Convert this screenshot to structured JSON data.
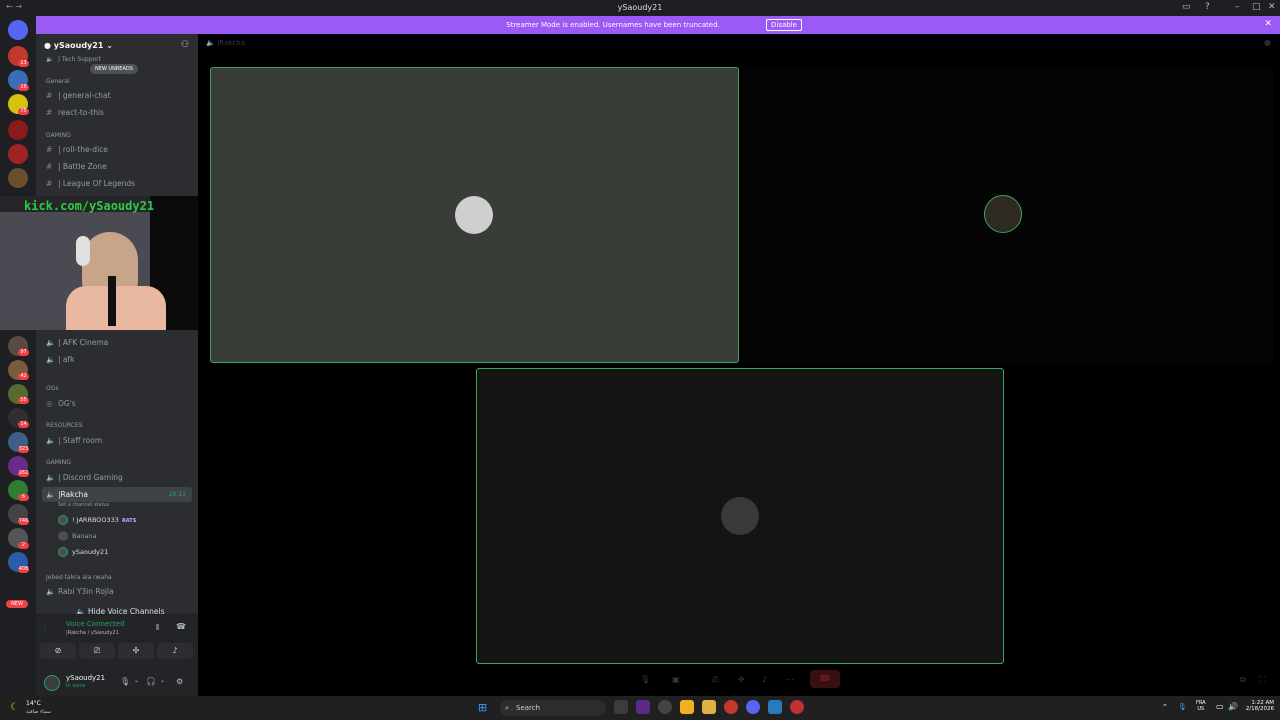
{
  "window": {
    "title": "ySaoudy21"
  },
  "banner": {
    "message": "Streamer Mode is enabled. Usernames have been truncated.",
    "disable_label": "Disable"
  },
  "server": {
    "name": "ySaoudy21",
    "new_unreads": "NEW UNREADS"
  },
  "channels": {
    "tech_support": "| Tech Support",
    "cat_general": "General",
    "general_chat": "| general-chat",
    "react_to_this": "react-to-this",
    "cat_gaming": "GAMING",
    "roll_the_dice": "| roll-the-dice",
    "battle_zone": "| Battle Zone",
    "league": "| League Of Legends",
    "afk_cinema": "| AFK Cinema",
    "afk": "| afk",
    "cat_ogs": "OGs",
    "ogs": "OG's",
    "cat_resources": "RESOURCES",
    "staff_room": "| Staff room",
    "cat_gaming2": "GAMING",
    "discord_gaming": "| Discord Gaming",
    "rakcha": "|Rakcha",
    "rakcha_timer": "26:11",
    "rakcha_status": "Set a channel status",
    "users": [
      "! JARRBOO333",
      "Banana",
      "ySaoudy21"
    ],
    "rats_tag": "RATS",
    "cat_jebed": "Jebed takra ala rwaha",
    "rabi": "Rabi Y3in Rojla",
    "hide_voice": "Hide Voice Channels"
  },
  "voice": {
    "title": "Voice Connected",
    "sub": "|Rakcha / ySaoudy21"
  },
  "user": {
    "name": "ySaoudy21",
    "status": "In voice"
  },
  "webcam": {
    "overlay": "kick.com/ySaoudy21"
  },
  "main": {
    "header": "|Rakcha"
  },
  "taskbar": {
    "weather_temp": "14°C",
    "weather_desc": "سماء صافية",
    "search": "Search",
    "lang1": "FRA",
    "lang2": "US",
    "time": "1:22 AM",
    "date": "2/18/2026"
  },
  "guild_badges": [
    "13",
    "16",
    "75",
    "97",
    "42",
    "55",
    "14",
    "323",
    "262",
    "6",
    "746",
    "2",
    "408"
  ],
  "colors": {
    "accent": "#9b59f5",
    "speaking": "#3ba55c",
    "online": "#23a55a"
  }
}
